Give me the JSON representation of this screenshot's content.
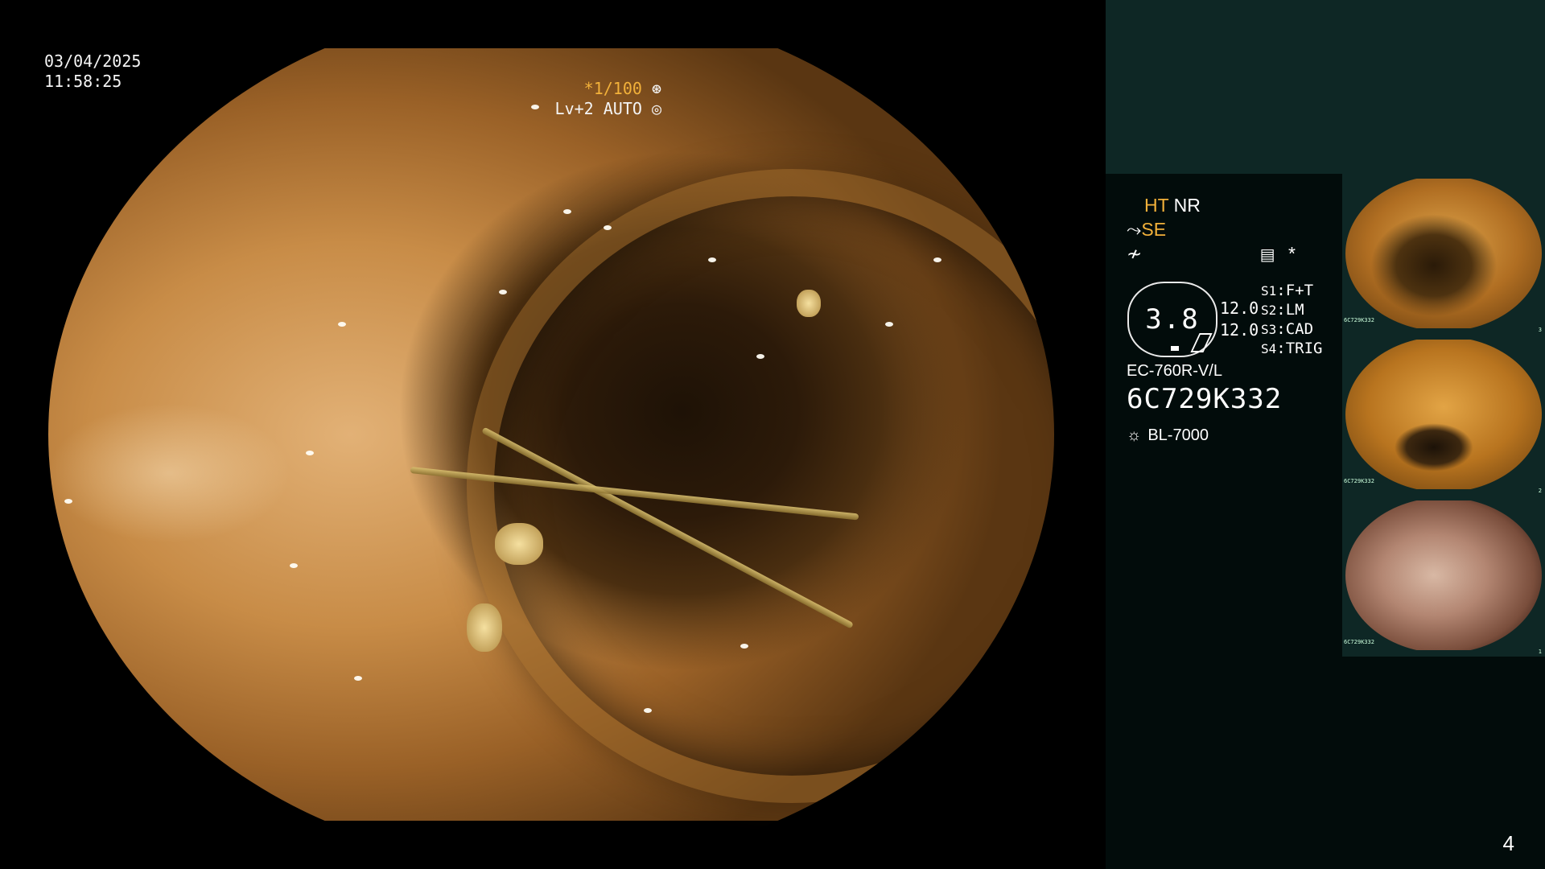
{
  "overlay": {
    "date": "03/04/2025",
    "time": "11:58:25",
    "shutter": "*1/100",
    "level": "Lv+2 AUTO"
  },
  "panel": {
    "ht": "HT",
    "nr": "NR",
    "se": "SE",
    "mode_value": "3.8",
    "num_top": "12.0",
    "num_bottom": "12.0",
    "presets": [
      {
        "key": "S1",
        "value": "F+T"
      },
      {
        "key": "S2",
        "value": "LM"
      },
      {
        "key": "S3",
        "value": "CAD"
      },
      {
        "key": "S4",
        "value": "TRIG"
      }
    ],
    "asterisk": "*",
    "scope_model": "EC-760R-V/L",
    "scope_serial": "6C729K332",
    "light_source": "BL-7000"
  },
  "thumbnails": [
    {
      "index": "3",
      "serial": "6C729K332"
    },
    {
      "index": "2",
      "serial": "6C729K332"
    },
    {
      "index": "1",
      "serial": "6C729K332"
    }
  ],
  "page_number": "4",
  "colors": {
    "accent_orange": "#f2b13a",
    "panel_bg": "#020c0b",
    "panel_header": "#0e2725"
  }
}
